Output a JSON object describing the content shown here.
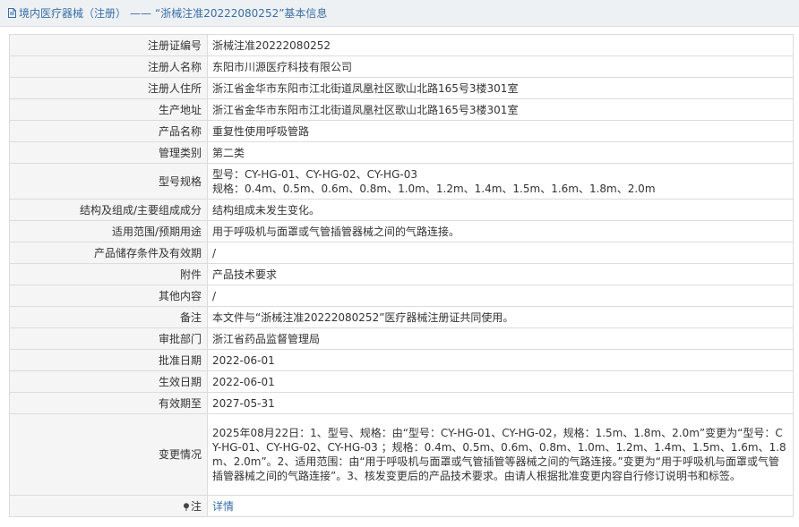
{
  "breadcrumb": {
    "section": "境内医疗器械（注册）",
    "separator": "——",
    "record_title": "“浙械注准20222080252”基本信息"
  },
  "rows": [
    {
      "label": "注册证编号",
      "value": "浙械注准20222080252"
    },
    {
      "label": "注册人名称",
      "value": "东阳市川源医疗科技有限公司"
    },
    {
      "label": "注册人住所",
      "value": "浙江省金华市东阳市江北街道凤凰社区歌山北路165号3楼301室"
    },
    {
      "label": "生产地址",
      "value": "浙江省金华市东阳市江北街道凤凰社区歌山北路165号3楼301室"
    },
    {
      "label": "产品名称",
      "value": "重复性使用呼吸管路"
    },
    {
      "label": "管理类别",
      "value": "第二类"
    },
    {
      "label": "型号规格",
      "value_line1": "型号：CY-HG-01、CY-HG-02、CY-HG-03",
      "value_line2": "规格：0.4m、0.5m、0.6m、0.8m、1.0m、1.2m、1.4m、1.5m、1.6m、1.8m、2.0m"
    },
    {
      "label": "结构及组成/主要组成成分",
      "value": "结构组成未发生变化。"
    },
    {
      "label": "适用范围/预期用途",
      "value": "用于呼吸机与面罩或气管插管器械之间的气路连接。"
    },
    {
      "label": "产品储存条件及有效期",
      "value": "/"
    },
    {
      "label": "附件",
      "value": "产品技术要求"
    },
    {
      "label": "其他内容",
      "value": "/"
    },
    {
      "label": "备注",
      "value": "本文件与“浙械注准20222080252”医疗器械注册证共同使用。"
    },
    {
      "label": "审批部门",
      "value": "浙江省药品监督管理局"
    },
    {
      "label": "批准日期",
      "value": "2022-06-01"
    },
    {
      "label": "生效日期",
      "value": "2022-06-01"
    },
    {
      "label": "有效期至",
      "value": "2027-05-31"
    },
    {
      "label": "变更情况",
      "value": "2025年08月22日：1、型号、规格：由“型号：CY-HG-01、CY-HG-02，规格：1.5m、1.8m、2.0m”变更为“型号：CY-HG-01、CY-HG-02、CY-HG-03 ；规格：0.4m、0.5m、0.6m、0.8m、1.0m、1.2m、1.4m、1.5m、1.6m、1.8m、2.0m”。2、适用范围：由“用于呼吸机与面罩或气管插管等器械之间的气路连接。”变更为“用于呼吸机与面罩或气管插管器械之间的气路连接”。3、核发变更后的产品技术要求。由请人根据批准变更内容自行修订说明书和标签。"
    },
    {
      "label": "注",
      "value": "详情"
    }
  ],
  "icons": {
    "breadcrumb_icon": "document-icon",
    "note_icon": "pin-icon"
  },
  "colors": {
    "header_bg": "#eef1f4",
    "link": "#3a6ea5",
    "label_bg": "#f5f5f5",
    "border": "#dcdcdc"
  }
}
